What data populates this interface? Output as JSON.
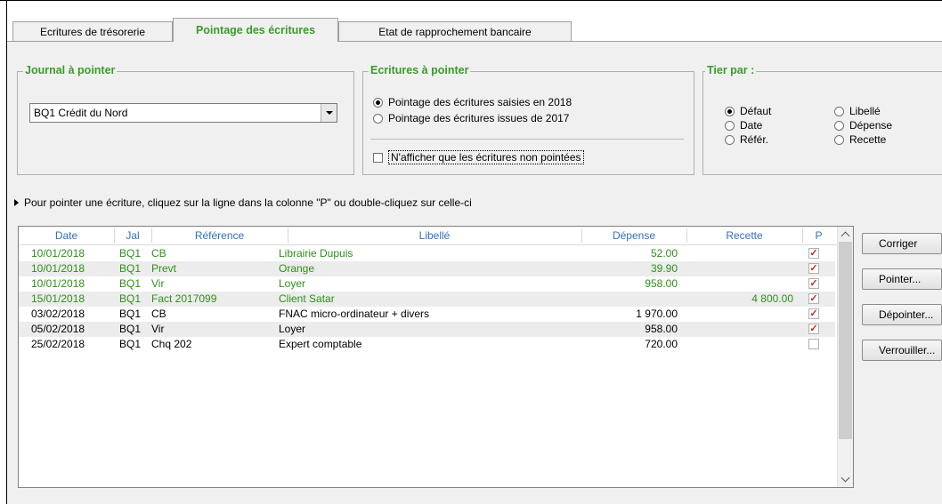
{
  "tabs": [
    {
      "label": "Ecritures de trésorerie",
      "active": false
    },
    {
      "label": "Pointage des écritures",
      "active": true
    },
    {
      "label": "Etat de rapprochement bancaire",
      "active": false
    }
  ],
  "journal_group": {
    "legend": "Journal à pointer",
    "selected": "BQ1 Crédit du Nord"
  },
  "ecritures_group": {
    "legend": "Ecritures à pointer",
    "options": [
      {
        "label": "Pointage des écritures saisies en 2018",
        "selected": true
      },
      {
        "label": "Pointage des écritures issues de 2017",
        "selected": false
      }
    ],
    "checkbox_label": "N'afficher que les écritures non pointées",
    "checkbox_checked": false
  },
  "tri_group": {
    "legend": "Tier par :",
    "options": [
      {
        "label": "Défaut",
        "selected": true
      },
      {
        "label": "Date",
        "selected": false
      },
      {
        "label": "Référ.",
        "selected": false
      },
      {
        "label": "Libellé",
        "selected": false
      },
      {
        "label": "Dépense",
        "selected": false
      },
      {
        "label": "Recette",
        "selected": false
      }
    ]
  },
  "hint": "Pour pointer une écriture, cliquez sur la ligne dans la colonne \"P\"  ou double-cliquez sur celle-ci",
  "table": {
    "columns": [
      "Date",
      "Jal",
      "Référence",
      "Libellé",
      "Dépense",
      "Recette",
      "P"
    ],
    "rows": [
      {
        "date": "10/01/2018",
        "jal": "BQ1",
        "ref": "CB",
        "libelle": "Librairie Dupuis",
        "depense": "52.00",
        "recette": "",
        "p": "✓",
        "color": "#2f8f1a"
      },
      {
        "date": "10/01/2018",
        "jal": "BQ1",
        "ref": "Prevt",
        "libelle": "Orange",
        "depense": "39.90",
        "recette": "",
        "p": "✓",
        "color": "#2f8f1a"
      },
      {
        "date": "10/01/2018",
        "jal": "BQ1",
        "ref": "Vir",
        "libelle": "Loyer",
        "depense": "958.00",
        "recette": "",
        "p": "✓",
        "color": "#2f8f1a"
      },
      {
        "date": "15/01/2018",
        "jal": "BQ1",
        "ref": "Fact 2017099",
        "libelle": "Client Satar",
        "depense": "",
        "recette": "4 800.00",
        "p": "✓",
        "color": "#2f8f1a"
      },
      {
        "date": "03/02/2018",
        "jal": "BQ1",
        "ref": "CB",
        "libelle": "FNAC micro-ordinateur + divers",
        "depense": "1 970.00",
        "recette": "",
        "p": "✓",
        "color": "#000000"
      },
      {
        "date": "05/02/2018",
        "jal": "BQ1",
        "ref": "Vir",
        "libelle": "Loyer",
        "depense": "958.00",
        "recette": "",
        "p": "✓",
        "color": "#000000"
      },
      {
        "date": "25/02/2018",
        "jal": "BQ1",
        "ref": "Chq 202",
        "libelle": "Expert comptable",
        "depense": "720.00",
        "recette": "",
        "p": "",
        "color": "#000000"
      }
    ]
  },
  "buttons": {
    "corriger": "Corriger",
    "pointer": "Pointer...",
    "depointer": "Dépointer...",
    "verrouiller": "Verrouiller..."
  },
  "colors": {
    "accent_green": "#3c9a2c",
    "header_blue": "#3470b8",
    "check_red": "#d02020"
  }
}
